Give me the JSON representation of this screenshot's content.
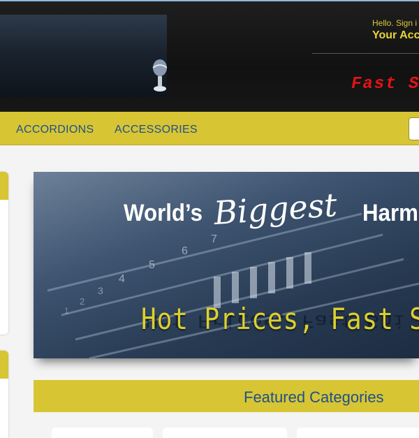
{
  "header": {
    "greeting": "Hello. Sign i",
    "account_label": "Your Acc",
    "tagline": "Fast S"
  },
  "nav": {
    "items": [
      {
        "label": "ACCORDIONS"
      },
      {
        "label": "ACCESSORIES"
      }
    ]
  },
  "hero": {
    "headline_part1": "World’s",
    "headline_script": "Biggest",
    "headline_part2": "Harmo",
    "slogan": "Hot Prices, Fast Shi",
    "slogan_reflection": "Hot Prices, Fast Shi",
    "number_marks": [
      "6",
      "5",
      "4",
      "3",
      "2",
      "1",
      "7"
    ]
  },
  "featured": {
    "title": "Featured Categories"
  },
  "colors": {
    "accent_yellow": "#d7c534",
    "link_blue": "#1f4f8c",
    "header_dark": "#171717",
    "tagline_red": "#e31414"
  }
}
